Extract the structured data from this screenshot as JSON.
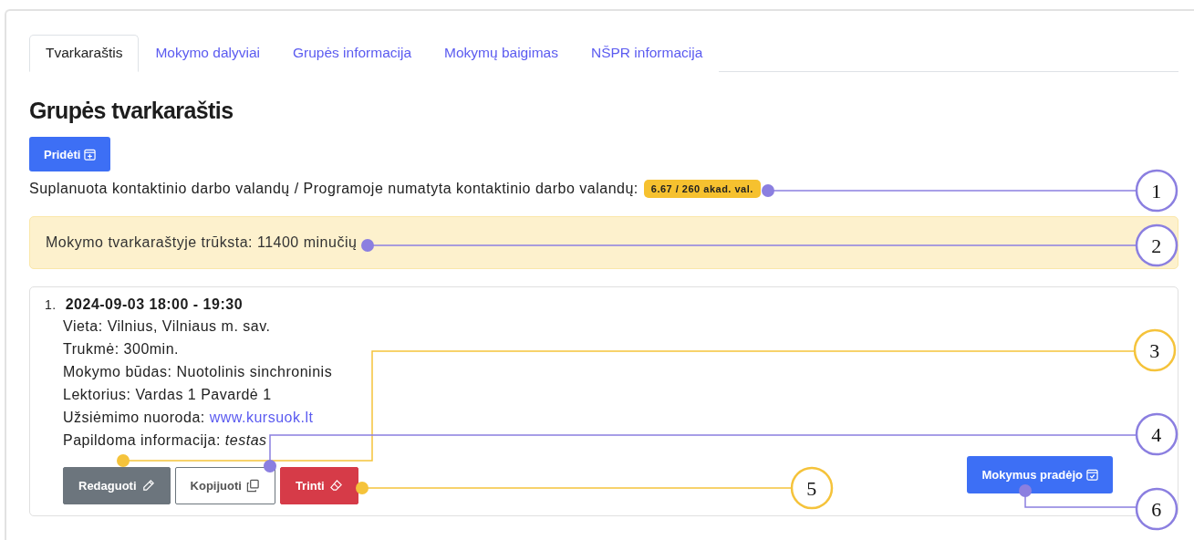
{
  "tabs": [
    {
      "label": "Tvarkaraštis",
      "selected": true
    },
    {
      "label": "Mokymo dalyviai",
      "selected": false
    },
    {
      "label": "Grupės informacija",
      "selected": false
    },
    {
      "label": "Mokymų baigimas",
      "selected": false
    },
    {
      "label": "NŠPR informacija",
      "selected": false
    }
  ],
  "heading": "Grupės tvarkaraštis",
  "add_button": "Pridėti",
  "hours_text": "Suplanuota kontaktinio darbo valandų / Programoje numatyta kontaktinio darbo valandų:",
  "hours_badge": "6.67 / 260 akad. val.",
  "alert": "Mokymo tvarkaraštyje trūksta: 11400 minučių",
  "sessions": [
    {
      "number": "1.",
      "title": "2024-09-03 18:00 - 19:30",
      "details": [
        {
          "kind": "text",
          "label": "Vieta:",
          "value": "Vilnius, Vilniaus m. sav."
        },
        {
          "kind": "text",
          "label": "Trukmė:",
          "value": "300min."
        },
        {
          "kind": "text",
          "label": "Mokymo būdas:",
          "value": "Nuotolinis sinchroninis"
        },
        {
          "kind": "text",
          "label": "Lektorius:",
          "value": "Vardas 1 Pavardė 1"
        },
        {
          "kind": "link",
          "label": "Užsiėmimo nuoroda:",
          "value": "www.kursuok.lt"
        },
        {
          "kind": "italic",
          "label": "Papildoma informacija:",
          "value": "testas"
        }
      ],
      "actions": [
        {
          "kind": "edit",
          "label": "Redaguoti"
        },
        {
          "kind": "copy",
          "label": "Kopijuoti"
        },
        {
          "kind": "delete",
          "label": "Trinti"
        }
      ],
      "status_button": "Mokymus pradėjo"
    }
  ],
  "callouts": [
    {
      "label": "1",
      "color": "#8b7fe0"
    },
    {
      "label": "2",
      "color": "#8b7fe0"
    },
    {
      "label": "3",
      "color": "#f5c33b"
    },
    {
      "label": "4",
      "color": "#8b7fe0"
    },
    {
      "label": "5",
      "color": "#f5c33b"
    },
    {
      "label": "6",
      "color": "#8b7fe0"
    }
  ]
}
